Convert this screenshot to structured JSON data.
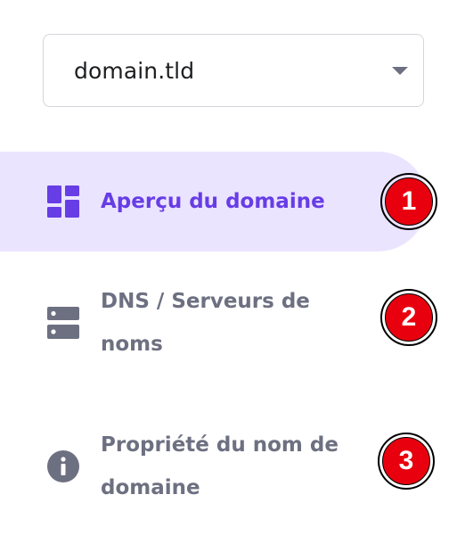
{
  "domain_select": {
    "value": "domain.tld"
  },
  "nav": {
    "items": [
      {
        "label": "Aperçu du domaine",
        "active": true,
        "icon": "dashboard-grid-icon",
        "badge": "1"
      },
      {
        "label": "DNS / Serveurs de noms",
        "active": false,
        "icon": "server-icon",
        "badge": "2"
      },
      {
        "label": "Propriété du nom de domaine",
        "active": false,
        "icon": "info-icon",
        "badge": "3"
      }
    ]
  },
  "colors": {
    "accent": "#673de6",
    "active_bg": "#ebe4ff",
    "muted_text": "#6d7081",
    "badge_red": "#e8000f"
  }
}
